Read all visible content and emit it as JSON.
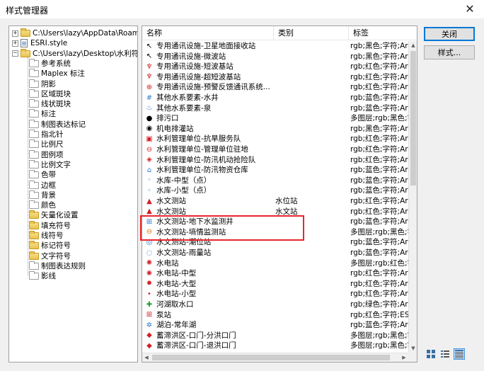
{
  "window": {
    "title": "样式管理器"
  },
  "buttons": {
    "close": "关闭",
    "styles": "样式..."
  },
  "tree": {
    "roots": [
      {
        "label": "C:\\Users\\lazy\\AppData\\Roaming\\E",
        "expander": "+"
      },
      {
        "label": "ESRI.style",
        "expander": "+"
      },
      {
        "label": "C:\\Users\\lazy\\Desktop\\水利符号库",
        "expander": "−"
      }
    ],
    "children": [
      "参考系统",
      "Maplex 标注",
      "阴影",
      "区域斑块",
      "线状斑块",
      "标注",
      "制图表达标记",
      "指北针",
      "比例尺",
      "图例项",
      "比例文字",
      "色带",
      "边框",
      "背景",
      "颜色",
      "矢量化设置",
      "填充符号",
      "线符号",
      "标记符号",
      "文字符号",
      "制图表达规则",
      "影线"
    ],
    "filled_children": [
      15,
      16,
      17,
      18,
      19
    ]
  },
  "list": {
    "columns": {
      "name": "名称",
      "category": "类别",
      "tags": "标签"
    },
    "rows": [
      {
        "name": "专用通讯设施-卫星地面接收站",
        "category": "",
        "tags": "rgb;黑色;字符;Arial",
        "icon": "satellite-dish-icon",
        "glyph": "↖",
        "color": "#000000"
      },
      {
        "name": "专用通讯设施-微波站",
        "category": "",
        "tags": "rgb;黑色;字符;Arial",
        "icon": "microwave-icon",
        "glyph": "↖",
        "color": "#000000"
      },
      {
        "name": "专用通讯设施-短波基站",
        "category": "",
        "tags": "rgb;红色;字符;Arial",
        "icon": "shortwave-icon",
        "glyph": "♆",
        "color": "#d31f26"
      },
      {
        "name": "专用通讯设施-超短波基站",
        "category": "",
        "tags": "rgb;红色;字符;Arial",
        "icon": "ultrashortwave-icon",
        "glyph": "♆",
        "color": "#d31f26"
      },
      {
        "name": "专用通讯设施-预警反馈通讯系统...",
        "category": "",
        "tags": "rgb;红色;字符;Arial",
        "icon": "warning-feedback-icon",
        "glyph": "⊕",
        "color": "#d31f26"
      },
      {
        "name": "其他水系要素-水井",
        "category": "",
        "tags": "rgb;蓝色;字符;Arial",
        "icon": "well-icon",
        "glyph": "#",
        "color": "#2e7bcf"
      },
      {
        "name": "其他水系要素-泉",
        "category": "",
        "tags": "rgb;蓝色;字符;Arial",
        "icon": "spring-icon",
        "glyph": "♨",
        "color": "#2e7bcf"
      },
      {
        "name": "排污口",
        "category": "",
        "tags": "多图层;rgb;黑色;字",
        "icon": "sewage-outlet-icon",
        "glyph": "●",
        "color": "#000000"
      },
      {
        "name": "机电排灌站",
        "category": "",
        "tags": "rgb;黑色;字符;Arial",
        "icon": "pump-irrigation-icon",
        "glyph": "◉",
        "color": "#000000"
      },
      {
        "name": "水利管理单位-抗旱服务队",
        "category": "",
        "tags": "rgb;红色;字符;Arial",
        "icon": "drought-service-icon",
        "glyph": "▣",
        "color": "#d31f26"
      },
      {
        "name": "水利管理单位-管理单位驻地",
        "category": "",
        "tags": "rgb;红色;字符;Arial",
        "icon": "management-unit-icon",
        "glyph": "⊖",
        "color": "#d31f26"
      },
      {
        "name": "水利管理单位-防汛机动抢险队",
        "category": "",
        "tags": "rgb;红色;字符;Arial",
        "icon": "flood-rescue-icon",
        "glyph": "◈",
        "color": "#d31f26"
      },
      {
        "name": "水利管理单位-防汛物资仓库",
        "category": "",
        "tags": "rgb;蓝色;字符;Arial",
        "icon": "flood-warehouse-icon",
        "glyph": "⌂",
        "color": "#2e7bcf"
      },
      {
        "name": "水库-中型（点）",
        "category": "",
        "tags": "rgb;蓝色;字符;Arial",
        "icon": "reservoir-medium-icon",
        "glyph": "◦",
        "color": "#2e7bcf"
      },
      {
        "name": "水库-小型（点）",
        "category": "",
        "tags": "rgb;蓝色;字符;Arial",
        "icon": "reservoir-small-icon",
        "glyph": "◦",
        "color": "#2e7bcf"
      },
      {
        "name": "水文测站",
        "category": "水位站",
        "tags": "rgb;红色;字符;Arial",
        "icon": "hydrometric-station-icon",
        "glyph": "▲",
        "color": "#d31f26"
      },
      {
        "name": "水文测站",
        "category": "水文站",
        "tags": "rgb;红色;字符;Arial",
        "icon": "hydrometric-station-icon",
        "glyph": "▲",
        "color": "#d31f26"
      },
      {
        "name": "水文测站-地下水监测井",
        "category": "",
        "tags": "rgb;蓝色;字符;Arial",
        "icon": "groundwater-well-icon",
        "glyph": "⊞",
        "color": "#2e7bcf"
      },
      {
        "name": "水文测站-墒情监测站",
        "category": "",
        "tags": "多图层;rgb;黑色;字",
        "icon": "soil-moisture-icon",
        "glyph": "⊖",
        "color": "#e07b00"
      },
      {
        "name": "水文测站-潮位站",
        "category": "",
        "tags": "rgb;蓝色;字符;Arial",
        "icon": "tide-station-icon",
        "glyph": "◎",
        "color": "#2e7bcf"
      },
      {
        "name": "水文测站-雨量站",
        "category": "",
        "tags": "rgb;蓝色;字符;Arial",
        "icon": "rain-gauge-icon",
        "glyph": "◌",
        "color": "#2e7bcf"
      },
      {
        "name": "水电站",
        "category": "",
        "tags": "多图层;rgb;红色;字",
        "icon": "hydropower-icon",
        "glyph": "✺",
        "color": "#d31f26"
      },
      {
        "name": "水电站-中型",
        "category": "",
        "tags": "rgb;红色;字符;Arial",
        "icon": "hydropower-medium-icon",
        "glyph": "✺",
        "color": "#d31f26"
      },
      {
        "name": "水电站-大型",
        "category": "",
        "tags": "rgb;红色;字符;Arial",
        "icon": "hydropower-large-icon",
        "glyph": "✹",
        "color": "#d31f26"
      },
      {
        "name": "水电站-小型",
        "category": "",
        "tags": "rgb;红色;字符;Arial",
        "icon": "hydropower-small-icon",
        "glyph": "•",
        "color": "#d31f26"
      },
      {
        "name": "河湖取水口",
        "category": "",
        "tags": "rgb;绿色;字符;Arial",
        "icon": "water-intake-icon",
        "glyph": "✚",
        "color": "#1d9a2e"
      },
      {
        "name": "泵站",
        "category": "",
        "tags": "rgb;红色;字符;ESR",
        "icon": "pump-station-icon",
        "glyph": "⊞",
        "color": "#d31f26"
      },
      {
        "name": "湖泊-常年湖",
        "category": "",
        "tags": "rgb;蓝色;字符;Arial",
        "icon": "lake-icon",
        "glyph": "✲",
        "color": "#2e7bcf"
      },
      {
        "name": "蓄滞洪区-口门-分洪口门",
        "category": "",
        "tags": "多图层;rgb;黑色;字",
        "icon": "flood-gate-icon",
        "glyph": "◆",
        "color": "#d31f26"
      },
      {
        "name": "蓄滞洪区-口门-退洪口门",
        "category": "",
        "tags": "多图层;rgb;黑色;字",
        "icon": "flood-return-gate-icon",
        "glyph": "◆",
        "color": "#d31f26"
      }
    ]
  },
  "view_modes": [
    {
      "name": "large-icons-view-button",
      "icon": "large-icons-icon",
      "active": false
    },
    {
      "name": "list-view-button",
      "icon": "list-icon",
      "active": false
    },
    {
      "name": "details-view-button",
      "icon": "details-icon",
      "active": true
    }
  ]
}
